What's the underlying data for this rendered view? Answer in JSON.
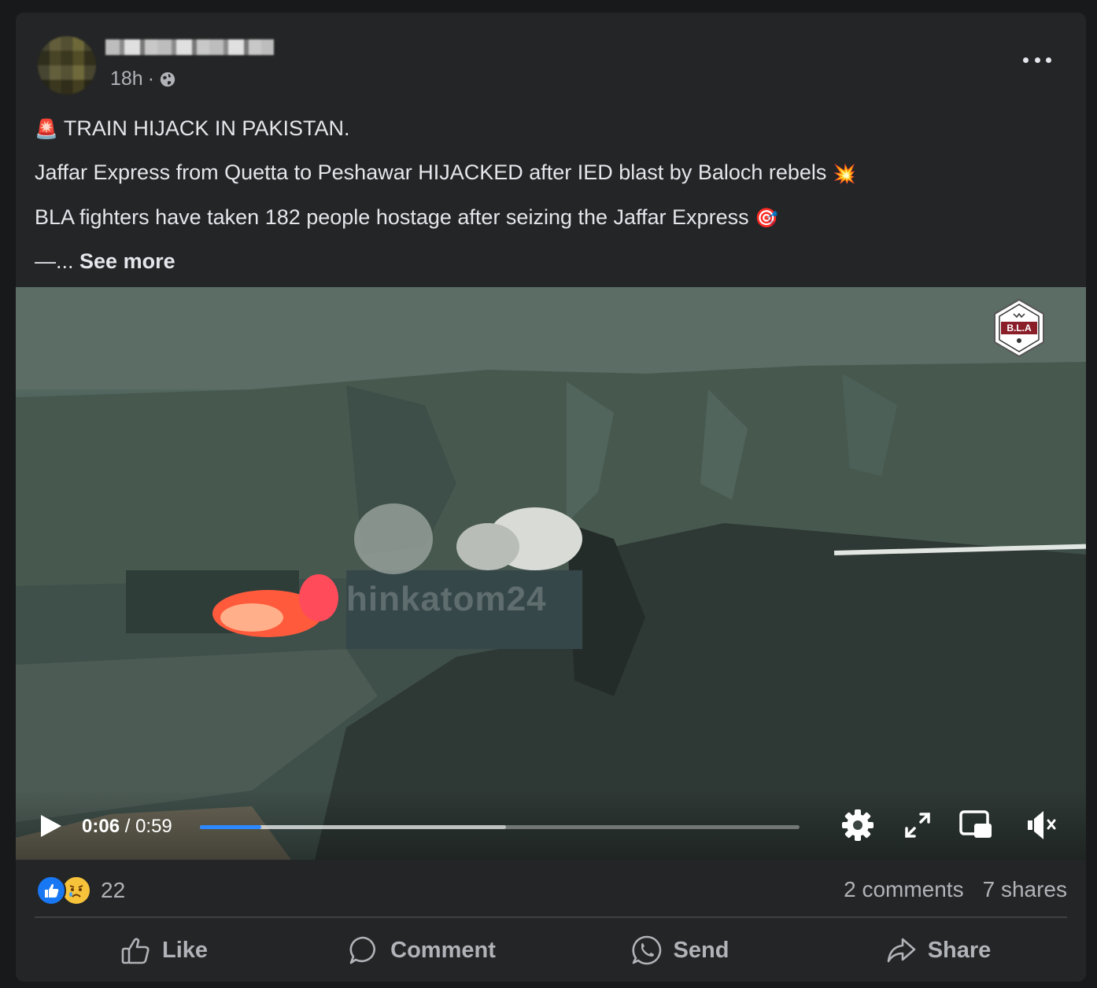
{
  "post": {
    "time": "18h",
    "separator": "·",
    "privacy_icon": "globe-icon",
    "menu_icon": "more-horizontal-icon",
    "lines": [
      {
        "emoji": "🚨",
        "text": "TRAIN HIJACK IN PAKISTAN."
      },
      {
        "text": "Jaffar Express from Quetta to Peshawar HIJACKED after IED blast by Baloch rebels",
        "emoji_after": "💥"
      },
      {
        "text": "BLA fighters have taken 182 people hostage after seizing the Jaffar Express",
        "emoji_after": "🎯"
      }
    ],
    "truncation": "—...",
    "see_more": "See more"
  },
  "video": {
    "watermark": "hinkatom24",
    "logo_text": "B.L.A",
    "current_time": "0:06",
    "time_separator": " / ",
    "duration": "0:59",
    "played_fraction": 0.103,
    "buffered_fraction": 0.51,
    "colors": {
      "progress": "#2d88ff"
    },
    "icons": [
      "play-icon",
      "settings-gear-icon",
      "fullscreen-icon",
      "picture-in-picture-icon",
      "muted-speaker-icon"
    ]
  },
  "stats": {
    "reaction_count": "22",
    "comments": "2 comments",
    "shares": "7 shares",
    "reaction_icons": [
      "like-reaction-icon",
      "sad-reaction-icon"
    ]
  },
  "actions": [
    {
      "label": "Like",
      "icon": "thumbs-up-icon"
    },
    {
      "label": "Comment",
      "icon": "comment-bubble-icon"
    },
    {
      "label": "Send",
      "icon": "whatsapp-icon"
    },
    {
      "label": "Share",
      "icon": "share-arrow-icon"
    }
  ]
}
